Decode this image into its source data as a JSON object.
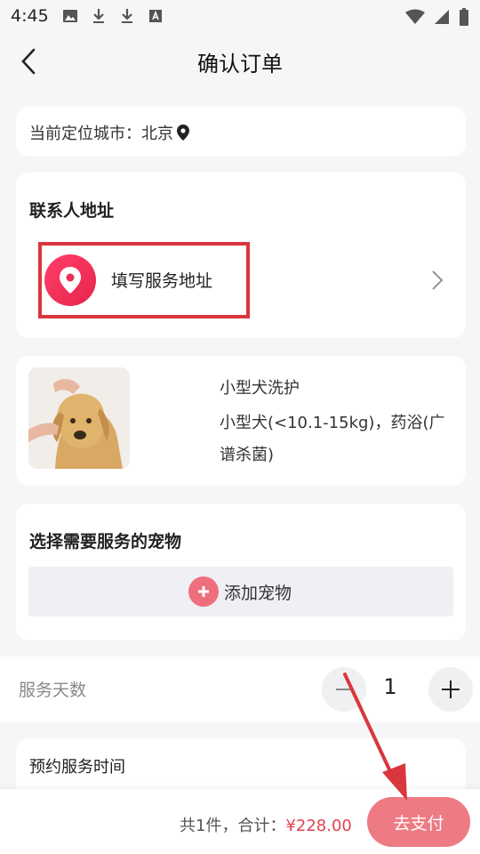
{
  "status_bar": {
    "time": "4:45"
  },
  "header": {
    "title": "确认订单"
  },
  "city": {
    "label": "当前定位城市：北京"
  },
  "contact": {
    "section_title": "联系人地址",
    "address_placeholder": "填写服务地址"
  },
  "product": {
    "name": "小型犬洗护",
    "description": "小型犬(<10.1-15kg)，药浴(广谱杀菌)"
  },
  "pets": {
    "section_title": "选择需要服务的宠物",
    "add_label": "添加宠物"
  },
  "service_days": {
    "label": "服务天数",
    "value": "1"
  },
  "appointment": {
    "label": "预约服务时间"
  },
  "footer": {
    "summary_prefix": "共1件，合计：",
    "total": "¥228.00",
    "pay_label": "去支付"
  },
  "colors": {
    "accent": "#ee7a84",
    "price": "#e2424f",
    "highlight": "#d9363e"
  }
}
